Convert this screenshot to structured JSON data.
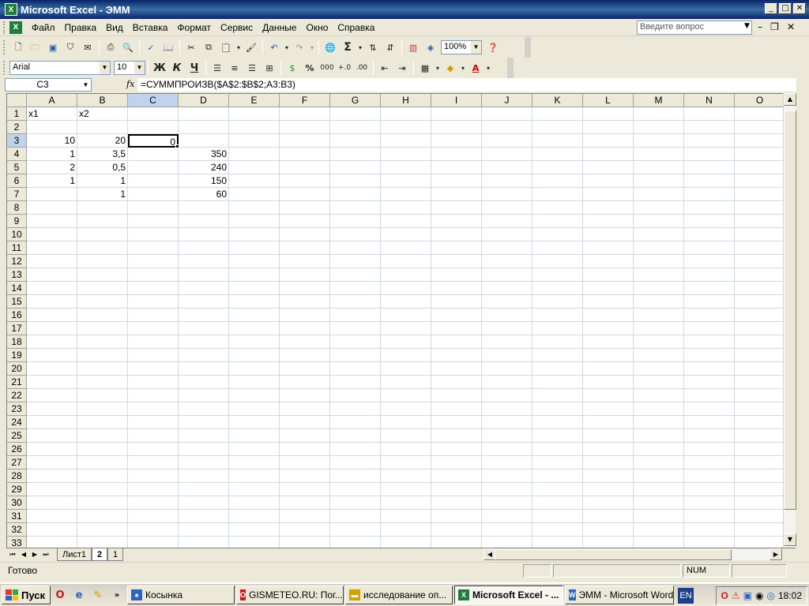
{
  "window": {
    "title": "Microsoft Excel - ЭММ",
    "app_icon_letter": "X",
    "min_label": "_",
    "max_label": "□",
    "close_label": "✕"
  },
  "menubar": {
    "items": [
      "Файл",
      "Правка",
      "Вид",
      "Вставка",
      "Формат",
      "Сервис",
      "Данные",
      "Окно",
      "Справка"
    ],
    "ask_placeholder": "Введите вопрос"
  },
  "toolbar_standard": {
    "zoom": "100%",
    "icons": [
      "new-icon",
      "open-icon",
      "save-icon",
      "permission-icon",
      "email-icon",
      "print-icon",
      "print-preview-icon",
      "spelling-icon",
      "research-icon",
      "cut-icon",
      "copy-icon",
      "paste-icon",
      "format-painter-icon",
      "undo-icon",
      "redo-icon",
      "hyperlink-icon",
      "autosum-icon",
      "sort-asc-icon",
      "sort-desc-icon",
      "chart-wizard-icon",
      "drawing-icon",
      "help-icon"
    ]
  },
  "toolbar_formatting": {
    "font": "Arial",
    "size": "10",
    "bold": "Ж",
    "italic": "К",
    "underline": "Ч",
    "percent": "%",
    "thousands": "000"
  },
  "formula_bar": {
    "namebox": "C3",
    "fx_label": "fx",
    "formula": "=СУММПРОИЗВ($A$2:$B$2;A3:B3)"
  },
  "sheet": {
    "columns": [
      "A",
      "B",
      "C",
      "D",
      "E",
      "F",
      "G",
      "H",
      "I",
      "J",
      "K",
      "L",
      "M",
      "N",
      "O"
    ],
    "selected_column": "C",
    "selected_row": 3,
    "rows": 33,
    "cells": [
      {
        "ref": "A1",
        "value": "x1",
        "align": "left"
      },
      {
        "ref": "B1",
        "value": "x2",
        "align": "left"
      },
      {
        "ref": "A3",
        "value": "10",
        "align": "right"
      },
      {
        "ref": "B3",
        "value": "20",
        "align": "right"
      },
      {
        "ref": "C3",
        "value": "0",
        "align": "right"
      },
      {
        "ref": "A4",
        "value": "1",
        "align": "right"
      },
      {
        "ref": "B4",
        "value": "3,5",
        "align": "right"
      },
      {
        "ref": "D4",
        "value": "350",
        "align": "right"
      },
      {
        "ref": "A5",
        "value": "2",
        "align": "right"
      },
      {
        "ref": "B5",
        "value": "0,5",
        "align": "right"
      },
      {
        "ref": "D5",
        "value": "240",
        "align": "right"
      },
      {
        "ref": "A6",
        "value": "1",
        "align": "right"
      },
      {
        "ref": "B6",
        "value": "1",
        "align": "right"
      },
      {
        "ref": "D6",
        "value": "150",
        "align": "right"
      },
      {
        "ref": "B7",
        "value": "1",
        "align": "right"
      },
      {
        "ref": "D7",
        "value": "60",
        "align": "right"
      }
    ],
    "tabs": [
      "Лист1",
      "2",
      "1"
    ],
    "active_tab": "2"
  },
  "statusbar": {
    "ready": "Готово",
    "num": "NUM"
  },
  "taskbar": {
    "start": "Пуск",
    "buttons": [
      {
        "label": "Косынка",
        "icon": "solitaire-icon",
        "active": false
      },
      {
        "label": "GISMETEO.RU: Пог...",
        "icon": "opera-icon",
        "active": false
      },
      {
        "label": "исследование оп...",
        "icon": "folder-icon",
        "active": false
      },
      {
        "label": "Microsoft Excel - ...",
        "icon": "excel-icon",
        "active": true
      },
      {
        "label": "ЭММ - Microsoft Word",
        "icon": "word-icon",
        "active": false
      }
    ],
    "lang": "EN",
    "clock": "18:02"
  }
}
